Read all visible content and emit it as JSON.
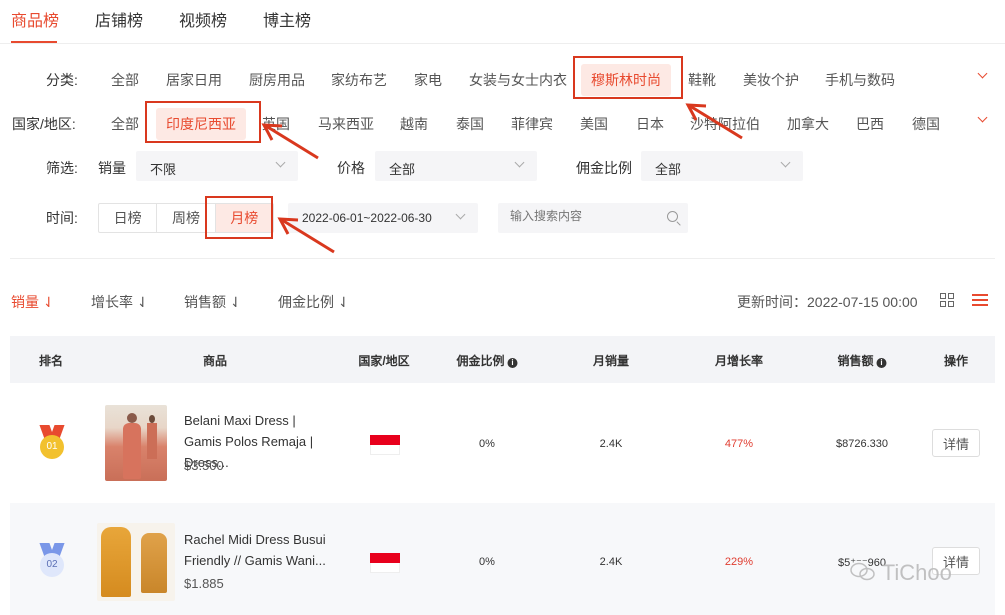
{
  "tabs": [
    "商品榜",
    "店铺榜",
    "视频榜",
    "博主榜"
  ],
  "category": {
    "label": "分类:",
    "items": [
      "全部",
      "居家日用",
      "厨房用品",
      "家纺布艺",
      "家电",
      "女装与女士内衣",
      "穆斯林时尚",
      "鞋靴",
      "美妆个护",
      "手机与数码"
    ],
    "active": "穆斯林时尚"
  },
  "region": {
    "label": "国家/地区:",
    "items": [
      "全部",
      "印度尼西亚",
      "英国",
      "马来西亚",
      "越南",
      "泰国",
      "菲律宾",
      "美国",
      "日本",
      "沙特阿拉伯",
      "加拿大",
      "巴西",
      "德国"
    ],
    "active": "印度尼西亚"
  },
  "filter": {
    "label": "筛选:",
    "sales_label": "销量",
    "sales_value": "不限",
    "price_label": "价格",
    "price_value": "全部",
    "commission_label": "佣金比例",
    "commission_value": "全部"
  },
  "time": {
    "label": "时间:",
    "options": [
      "日榜",
      "周榜",
      "月榜"
    ],
    "active": "月榜",
    "date_range": "2022-06-01~2022-06-30",
    "search_placeholder": "输入搜索内容"
  },
  "sort": {
    "items": [
      "销量",
      "增长率",
      "销售额",
      "佣金比例"
    ],
    "active": "销量",
    "update_time": "更新时间：2022-07-15 00:00"
  },
  "table": {
    "headers": [
      "排名",
      "商品",
      "国家/地区",
      "佣金比例",
      "月销量",
      "月增长率",
      "销售额",
      "操作"
    ],
    "rows": [
      {
        "rank": "01",
        "name": "Belani Maxi Dress | Gamis Polos Remaja | Dress...",
        "price": "$3.500",
        "commission": "0%",
        "monthly_sales": "2.4K",
        "growth": "477%",
        "revenue": "$8726.330",
        "action": "详情",
        "medal_color": "#f2c12e",
        "ribbon_color": "#e84a2f"
      },
      {
        "rank": "02",
        "name": "Rachel Midi Dress Busui Friendly // Gamis Wani...",
        "price": "$1.885",
        "commission": "0%",
        "monthly_sales": "2.4K",
        "growth": "229%",
        "revenue": "$5⁺⁻⁻960",
        "action": "详情",
        "medal_color": "#dfe7fb",
        "ribbon_color": "#7a97e8"
      }
    ]
  },
  "watermark": "TiChoo",
  "accent": "#e84a2f",
  "highlight": "#d9381e"
}
